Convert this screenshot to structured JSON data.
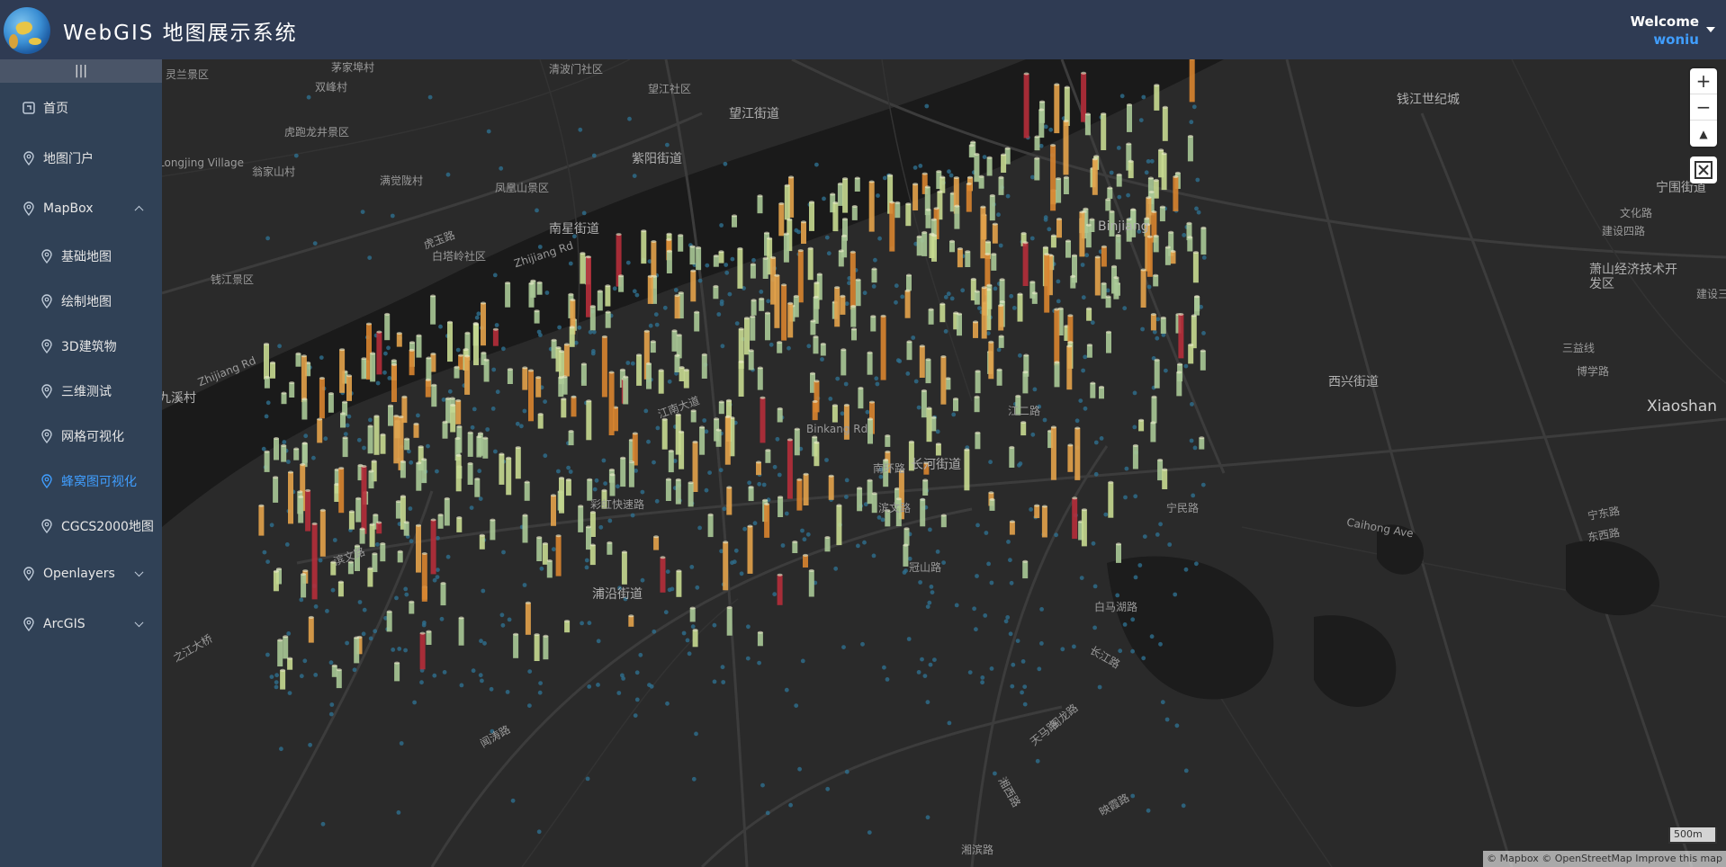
{
  "header": {
    "title": "WebGIS 地图展示系统",
    "welcome": "Welcome",
    "username": "woniu"
  },
  "sidebar": {
    "collapse_glyph": "|||",
    "items": [
      {
        "label": "首页",
        "icon": "home-icon"
      },
      {
        "label": "地图门户",
        "icon": "location-icon"
      },
      {
        "label": "MapBox",
        "icon": "location-icon",
        "expanded": true
      },
      {
        "label": "基础地图",
        "icon": "location-icon"
      },
      {
        "label": "绘制地图",
        "icon": "location-icon"
      },
      {
        "label": "3D建筑物",
        "icon": "location-icon"
      },
      {
        "label": "三维测试",
        "icon": "location-icon"
      },
      {
        "label": "网格可视化",
        "icon": "location-icon"
      },
      {
        "label": "蜂窝图可视化",
        "icon": "location-icon",
        "active": true
      },
      {
        "label": "CGCS2000地图",
        "icon": "location-icon"
      },
      {
        "label": "Openlayers",
        "icon": "location-icon",
        "expanded": false
      },
      {
        "label": "ArcGIS",
        "icon": "location-icon",
        "expanded": false
      }
    ],
    "active_color": "#409eff"
  },
  "map": {
    "labels": {
      "l1": "灵兰景区",
      "l2": "茅家埠村",
      "l3": "双峰村",
      "l4": "虎跑龙井景区",
      "l5": "Longjing Village",
      "l6": "翁家山村",
      "l7": "满觉陇村",
      "l8": "凤凰山景区",
      "l9": "钱江景区",
      "l10": "Zhijiang Rd",
      "l11": "九溪村",
      "l12": "之江大桥",
      "l13": "清波门社区",
      "l14": "望江社区",
      "l15": "望江街道",
      "l16": "紫阳街道",
      "l17": "南星街道",
      "l18": "白塔岭社区",
      "l19": "虎玉路",
      "l20": "Zhijiang Rd",
      "l21": "Binjiang",
      "l22": "钱江世纪城",
      "l23": "宁围街道",
      "l24": "萧山经济技术开发区",
      "l25": "Xiaoshan",
      "l26": "西兴街道",
      "l27": "长河街道",
      "l28": "南环路",
      "l29": "滨文路",
      "l30": "冠山路",
      "l31": "浦沿街道",
      "l32": "彩虹快速路",
      "l33": "江南大道",
      "l34": "Binkang Rd",
      "l35": "Caihong Ave",
      "l36": "建设四路",
      "l37": "文化路",
      "l38": "建设三路",
      "l39": "博学路",
      "l40": "三益线",
      "l41": "宁东路",
      "l42": "东西路",
      "l43": "长江路",
      "l44": "白马湖路",
      "l45": "天马路",
      "l46": "阁龙路",
      "l47": "湘西路",
      "l48": "映霞路",
      "l49": "湘滨路",
      "l50": "闻涛路",
      "l51": "宁民路",
      "l52": "江二路",
      "l53": "滨文路"
    },
    "zoom_in": "+",
    "zoom_out": "−",
    "compass": "▲",
    "scale": "500m",
    "attribution": "© Mapbox © OpenStreetMap  Improve this map",
    "hex_colors": [
      "#a8c896",
      "#c7d990",
      "#e3a24a",
      "#d8842f",
      "#b52d3a"
    ]
  }
}
